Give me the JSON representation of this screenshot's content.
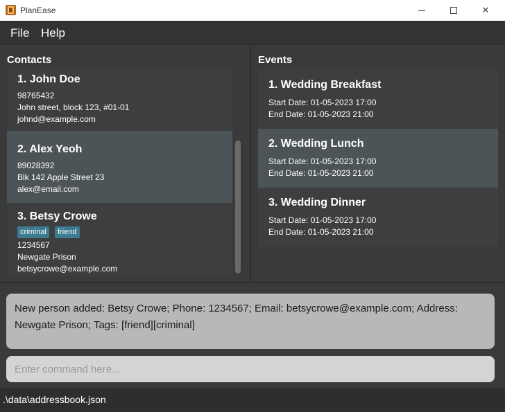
{
  "window": {
    "title": "PlanEase",
    "minimize_glyph": "",
    "maximize_glyph": "",
    "close_glyph": "✕"
  },
  "menu": {
    "file": "File",
    "help": "Help"
  },
  "contacts": {
    "heading": "Contacts",
    "items": [
      {
        "name": "1.  John Doe",
        "phone": "98765432",
        "address": "John street, block 123, #01-01",
        "email": "johnd@example.com",
        "tags": []
      },
      {
        "name": "2.  Alex Yeoh",
        "phone": "89028392",
        "address": "Blk 142 Apple Street 23",
        "email": "alex@email.com",
        "tags": []
      },
      {
        "name": "3.  Betsy Crowe",
        "phone": "1234567",
        "address": "Newgate Prison",
        "email": "betsycrowe@example.com",
        "tags": [
          "criminal",
          "friend"
        ]
      }
    ]
  },
  "events": {
    "heading": "Events",
    "items": [
      {
        "name": "1.  Wedding Breakfast",
        "start": "Start Date: 01-05-2023 17:00",
        "end": "End Date: 01-05-2023 21:00"
      },
      {
        "name": "2.  Wedding Lunch",
        "start": "Start Date: 01-05-2023 17:00",
        "end": "End Date: 01-05-2023 21:00"
      },
      {
        "name": "3.  Wedding Dinner",
        "start": "Start Date: 01-05-2023 17:00",
        "end": "End Date: 01-05-2023 21:00"
      }
    ]
  },
  "result": {
    "text": "New person added: Betsy Crowe; Phone: 1234567; Email: betsycrowe@example.com; Address: Newgate Prison; Tags: [friend][criminal]"
  },
  "command": {
    "placeholder": "Enter command here..."
  },
  "status": {
    "path": ".\\data\\addressbook.json"
  },
  "colors": {
    "background": "#3a3a3a",
    "selected_card": "#4c5457",
    "tag": "#3e7b91",
    "result_box": "#b8b8b8"
  }
}
